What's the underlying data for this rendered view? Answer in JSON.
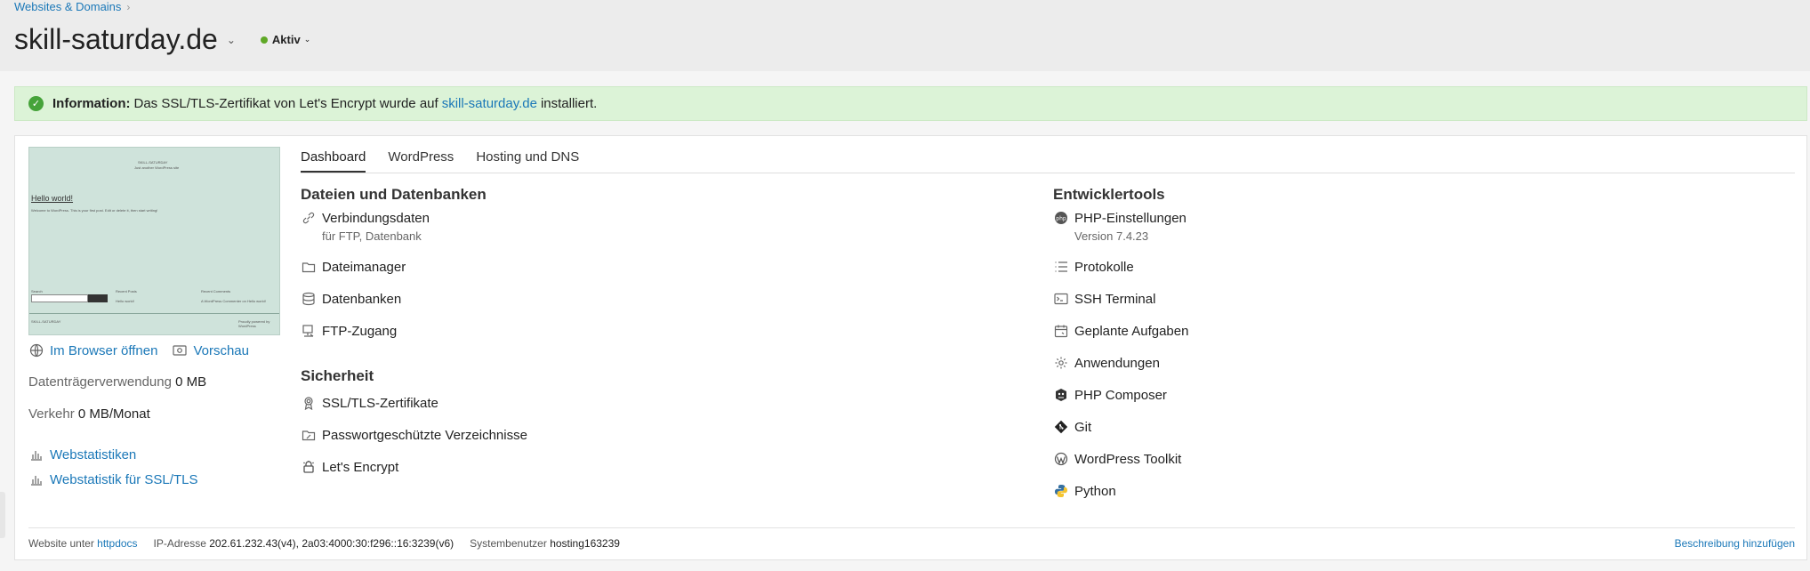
{
  "breadcrumb": {
    "item": "Websites & Domains"
  },
  "header": {
    "title": "skill-saturday.de",
    "status": "Aktiv"
  },
  "info": {
    "label": "Information:",
    "text_before": "Das SSL/TLS-Zertifikat von Let's Encrypt wurde auf",
    "link": "skill-saturday.de",
    "text_after": "installiert."
  },
  "preview": {
    "site_name": "SKILL-SATURDAY",
    "tagline": "Just another WordPress site",
    "hello": "Hello world!",
    "excerpt": "Welcome to WordPress. This is your first post. Edit or delete it, then start writing!",
    "search_label": "Search",
    "search_button": "Search",
    "recent_posts": "Recent Posts",
    "recent_comments": "Recent Comments",
    "hello_small": "Hello world!",
    "comment": "A WordPress Commenter on Hello world!",
    "footer_left": "SKILL-SATURDAY",
    "footer_right": "Proudly powered by WordPress"
  },
  "left": {
    "open_browser": "Im Browser öffnen",
    "preview": "Vorschau",
    "disk_label": "Datenträgerverwendung",
    "disk_value": "0 MB",
    "traffic_label": "Verkehr",
    "traffic_value": "0 MB/Monat",
    "webstats": "Webstatistiken",
    "webstats_ssl": "Webstatistik für SSL/TLS"
  },
  "tabs": [
    "Dashboard",
    "WordPress",
    "Hosting und DNS"
  ],
  "files": {
    "title": "Dateien und Datenbanken",
    "items": [
      {
        "label": "Verbindungsdaten",
        "sub": "für FTP, Datenbank",
        "icon": "link-icon"
      },
      {
        "label": "Dateimanager",
        "icon": "folder-icon"
      },
      {
        "label": "Datenbanken",
        "icon": "database-icon"
      },
      {
        "label": "FTP-Zugang",
        "icon": "ftp-icon"
      }
    ]
  },
  "security": {
    "title": "Sicherheit",
    "items": [
      {
        "label": "SSL/TLS-Zertifikate",
        "icon": "certificate-icon"
      },
      {
        "label": "Passwortgeschützte Verzeichnisse",
        "icon": "protected-folder-icon"
      },
      {
        "label": "Let's Encrypt",
        "icon": "lets-encrypt-icon"
      }
    ]
  },
  "dev": {
    "title": "Entwicklertools",
    "items": [
      {
        "label": "PHP-Einstellungen",
        "sub": "Version 7.4.23",
        "icon": "php-icon"
      },
      {
        "label": "Protokolle",
        "icon": "list-icon"
      },
      {
        "label": "SSH Terminal",
        "icon": "terminal-icon"
      },
      {
        "label": "Geplante Aufgaben",
        "icon": "calendar-icon"
      },
      {
        "label": "Anwendungen",
        "icon": "gear-icon"
      },
      {
        "label": "PHP Composer",
        "icon": "composer-icon"
      },
      {
        "label": "Git",
        "icon": "git-icon"
      },
      {
        "label": "WordPress Toolkit",
        "icon": "wordpress-icon"
      },
      {
        "label": "Python",
        "icon": "python-icon"
      }
    ]
  },
  "footer": {
    "site_label": "Website unter",
    "site_value": "httpdocs",
    "ip_label": "IP-Adresse",
    "ip_value": "202.61.232.43(v4), 2a03:4000:30:f296::16:3239(v6)",
    "user_label": "Systembenutzer",
    "user_value": "hosting163239",
    "add_description": "Beschreibung hinzufügen"
  }
}
